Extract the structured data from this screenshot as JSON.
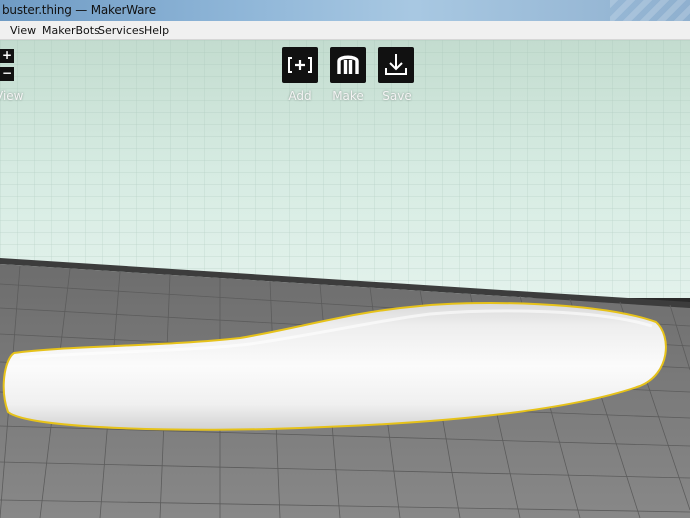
{
  "window": {
    "title": "buster.thing — MakerWare"
  },
  "menu": {
    "items": [
      "View",
      "MakerBots",
      "Services",
      "Help"
    ]
  },
  "toolbar": {
    "add_label": "Add",
    "make_label": "Make",
    "save_label": "Save",
    "add_icon": "add-bracket-icon",
    "make_icon": "makerbot-m-icon",
    "save_icon": "download-icon"
  },
  "zoom": {
    "plus": "+",
    "minus": "−",
    "view_label": "View"
  },
  "colors": {
    "wall": "#d8ece4",
    "floor": "#7c7c7c",
    "outline": "#e6c21a",
    "model": "#f2f2f2"
  }
}
